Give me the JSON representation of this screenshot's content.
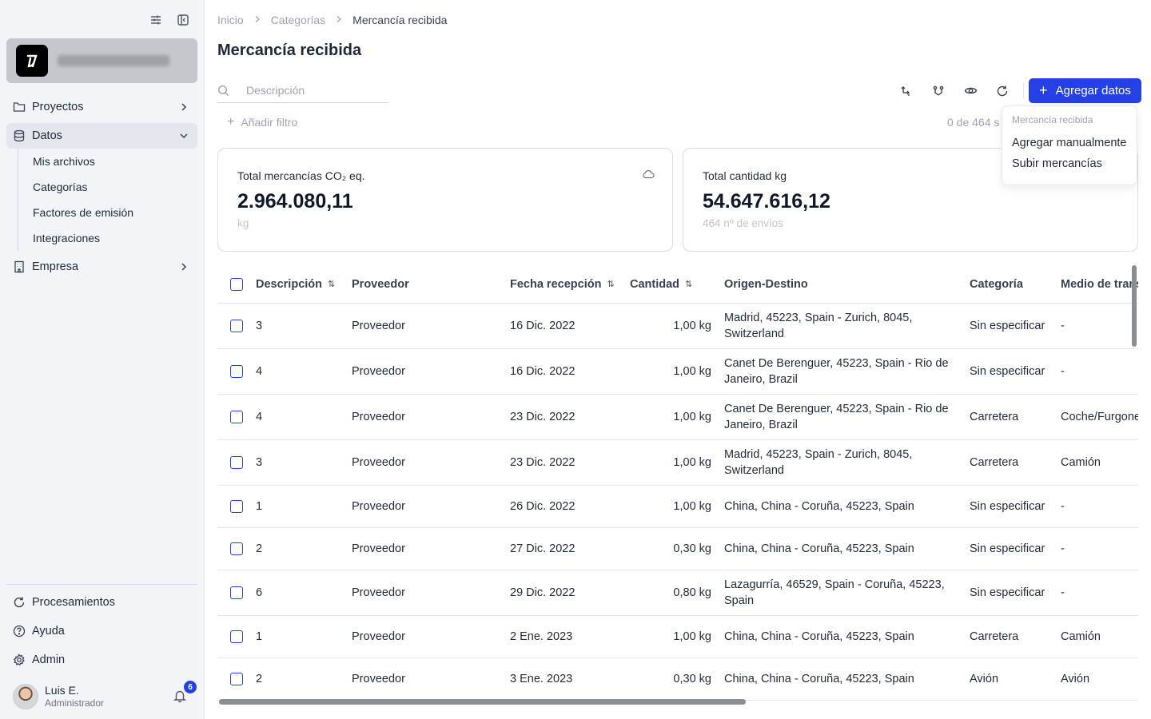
{
  "sidebar": {
    "nav": [
      {
        "label": "Proyectos"
      },
      {
        "label": "Datos"
      },
      {
        "label": "Empresa"
      }
    ],
    "datos_sub": [
      "Mis archivos",
      "Categorías",
      "Factores de emisión",
      "Integraciones"
    ],
    "bottom": [
      {
        "label": "Procesamientos"
      },
      {
        "label": "Ayuda"
      },
      {
        "label": "Admin"
      }
    ],
    "user": {
      "name": "Luis E.",
      "role": "Administrador",
      "notifications": "6"
    }
  },
  "breadcrumb": [
    "Inicio",
    "Categorías",
    "Mercancía recibida"
  ],
  "page_title": "Mercancía recibida",
  "search": {
    "placeholder": "Descripción"
  },
  "toolbar": {
    "add_label": "Agregar datos",
    "add_filter": "Añadir filtro",
    "selection": "0 de 464 s"
  },
  "dropdown": {
    "header": "Mercancía recibida",
    "items": [
      "Agregar manualmente",
      "Subir mercancías"
    ]
  },
  "cards": [
    {
      "title": "Total mercancías CO₂ eq.",
      "value": "2.964.080,11",
      "sub": "kg"
    },
    {
      "title": "Total cantidad kg",
      "value": "54.647.616,12",
      "sub": "464 nº de envíos"
    }
  ],
  "table": {
    "columns": [
      "Descripción",
      "Proveedor",
      "Fecha recepción",
      "Cantidad",
      "Origen-Destino",
      "Categoría",
      "Medio de trans"
    ],
    "rows": [
      {
        "desc": "3",
        "prov": "Proveedor",
        "date": "16 Dic. 2022",
        "qty": "1,00 kg",
        "orig": "Madrid, 45223, Spain - Zurich, 8045, Switzerland",
        "cat": "Sin especificar",
        "medio": "-"
      },
      {
        "desc": "4",
        "prov": "Proveedor",
        "date": "16 Dic. 2022",
        "qty": "1,00 kg",
        "orig": "Canet De Berenguer, 45223, Spain - Rio de Janeiro, Brazil",
        "cat": "Sin especificar",
        "medio": "-"
      },
      {
        "desc": "4",
        "prov": "Proveedor",
        "date": "23 Dic. 2022",
        "qty": "1,00 kg",
        "orig": "Canet De Berenguer, 45223, Spain - Rio de Janeiro, Brazil",
        "cat": "Carretera",
        "medio": "Coche/Furgone"
      },
      {
        "desc": "3",
        "prov": "Proveedor",
        "date": "23 Dic. 2022",
        "qty": "1,00 kg",
        "orig": "Madrid, 45223, Spain - Zurich, 8045, Switzerland",
        "cat": "Carretera",
        "medio": "Camión"
      },
      {
        "desc": "1",
        "prov": "Proveedor",
        "date": "26 Dic. 2022",
        "qty": "1,00 kg",
        "orig": "China, China - Coruña, 45223, Spain",
        "cat": "Sin especificar",
        "medio": "-"
      },
      {
        "desc": "2",
        "prov": "Proveedor",
        "date": "27 Dic. 2022",
        "qty": "0,30 kg",
        "orig": "China, China - Coruña, 45223, Spain",
        "cat": "Sin especificar",
        "medio": "-"
      },
      {
        "desc": "6",
        "prov": "Proveedor",
        "date": "29 Dic. 2022",
        "qty": "0,80 kg",
        "orig": "Lazagurría, 46529, Spain - Coruña, 45223, Spain",
        "cat": "Sin especificar",
        "medio": "-"
      },
      {
        "desc": "1",
        "prov": "Proveedor",
        "date": "2 Ene. 2023",
        "qty": "1,00 kg",
        "orig": "China, China - Coruña, 45223, Spain",
        "cat": "Carretera",
        "medio": "Camión"
      },
      {
        "desc": "2",
        "prov": "Proveedor",
        "date": "3 Ene. 2023",
        "qty": "0,30 kg",
        "orig": "China, China - Coruña, 45223, Spain",
        "cat": "Avión",
        "medio": "Avión"
      }
    ]
  },
  "colors": {
    "accent": "#2541e6",
    "sidebar_bg": "#f3f4f7"
  }
}
